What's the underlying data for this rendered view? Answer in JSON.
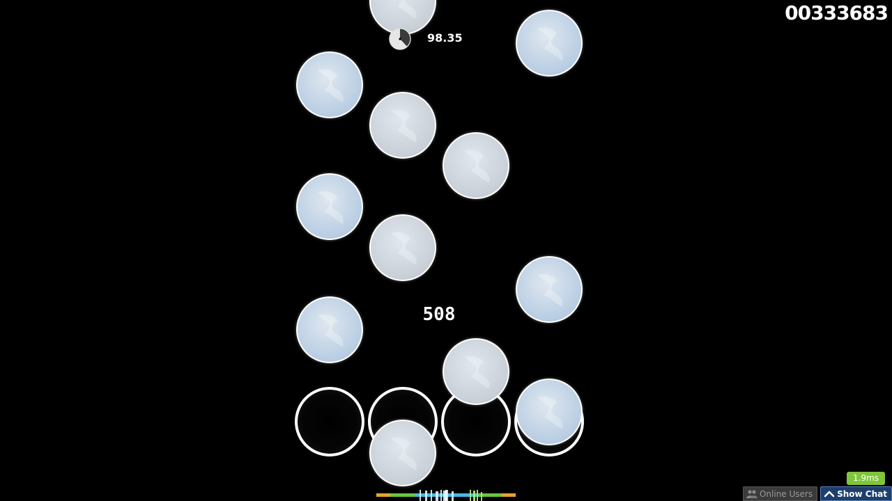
{
  "hud": {
    "score": "00333683",
    "accuracy": "98.35",
    "combo": "508",
    "song_progress": 0.38
  },
  "status": {
    "latency": "1.9ms"
  },
  "bottom_bar": {
    "online_users_label": "Online Users",
    "show_chat_label": "Show Chat"
  },
  "playfield": {
    "mode": "mania 4K",
    "lanes": 4,
    "note_color": "#b8cde3",
    "note_color_alt": "#c9cfd6",
    "receptor_color": "#ffffff",
    "notes": [
      {
        "lane": 1,
        "alt": true
      },
      {
        "lane": 3,
        "alt": false
      },
      {
        "lane": 0,
        "alt": false
      },
      {
        "lane": 1,
        "alt": true
      },
      {
        "lane": 2,
        "alt": true
      },
      {
        "lane": 0,
        "alt": false
      },
      {
        "lane": 1,
        "alt": true
      },
      {
        "lane": 3,
        "alt": false
      },
      {
        "lane": 0,
        "alt": false
      },
      {
        "lane": 2,
        "alt": true
      },
      {
        "lane": 3,
        "alt": false
      },
      {
        "lane": 1,
        "alt": true
      }
    ]
  },
  "icons": {
    "progress": "pie-progress-icon",
    "online_users": "users-icon",
    "show_chat": "chevron-up-icon"
  }
}
